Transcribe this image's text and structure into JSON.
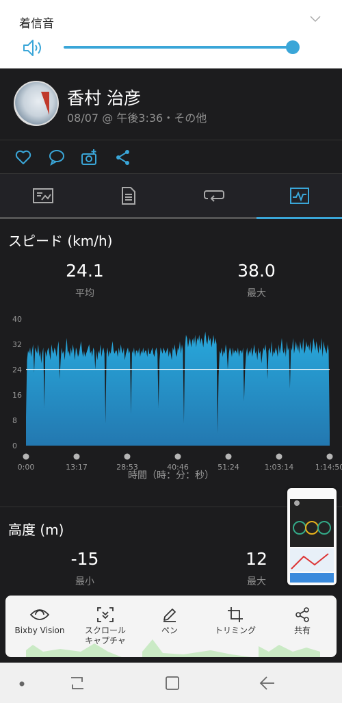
{
  "volume": {
    "title": "着信音",
    "level": 1.0
  },
  "activity": {
    "user_name": "香村 治彦",
    "meta": "08/07 @ 午後3:36・その他"
  },
  "actions": [
    "like-icon",
    "comment-icon",
    "add-photo-icon",
    "share-icon"
  ],
  "tabs": [
    {
      "name": "tab-overview",
      "icon": "map-stats-icon"
    },
    {
      "name": "tab-details",
      "icon": "document-icon"
    },
    {
      "name": "tab-laps",
      "icon": "laps-icon"
    },
    {
      "name": "tab-charts",
      "icon": "chart-icon",
      "selected": true
    }
  ],
  "speed": {
    "title": "スピード (km/h)",
    "avg_value": "24.1",
    "avg_label": "平均",
    "max_value": "38.0",
    "max_label": "最大"
  },
  "chart_data": {
    "type": "area",
    "title": "スピード (km/h)",
    "xlabel": "時間（時：分：秒）",
    "ylabel": "",
    "x_ticks": [
      "0:00",
      "13:17",
      "28:53",
      "40:46",
      "51:24",
      "1:03:14",
      "1:14:50"
    ],
    "y_ticks": [
      "0",
      "8",
      "16",
      "24",
      "32",
      "40"
    ],
    "ylim": [
      0,
      40
    ],
    "average_line": 24.1,
    "color": "#29a3d6",
    "values": [
      9,
      27,
      30,
      29,
      31,
      28,
      30,
      32,
      23,
      31,
      30,
      29,
      32,
      28,
      30,
      26,
      29,
      31,
      12,
      30,
      28,
      30,
      31,
      29,
      27,
      32,
      30,
      29,
      31,
      30,
      28,
      31,
      33,
      21,
      27,
      31,
      29,
      30,
      27,
      31,
      34,
      29,
      30,
      28,
      31,
      29,
      32,
      30,
      27,
      31,
      30,
      28,
      29,
      31,
      33,
      30,
      28,
      30,
      28,
      29,
      30,
      31,
      32,
      29,
      30,
      28,
      31,
      30,
      24,
      30,
      27,
      30,
      29,
      32,
      28,
      30,
      31,
      29,
      7,
      29,
      31,
      28,
      30,
      29,
      31,
      33,
      30,
      29,
      30,
      30,
      28,
      31,
      29,
      32,
      30,
      29,
      31,
      27,
      29,
      30,
      31,
      29,
      30,
      10,
      30,
      29,
      31,
      28,
      30,
      30,
      29,
      31,
      28,
      30,
      29,
      31,
      29,
      30,
      30,
      28,
      31,
      29,
      29,
      30,
      31,
      29,
      28,
      30,
      31,
      29,
      12,
      27,
      31,
      30,
      29,
      31,
      30,
      29,
      30,
      31,
      28,
      30,
      29,
      27,
      31,
      30,
      32,
      29,
      28,
      31,
      30,
      33,
      29,
      32,
      30,
      7,
      31,
      35,
      34,
      31,
      33,
      34,
      31,
      33,
      34,
      32,
      35,
      31,
      34,
      33,
      35,
      32,
      34,
      33,
      31,
      34,
      36,
      33,
      32,
      35,
      33,
      34,
      31,
      33,
      35,
      32,
      34,
      32,
      4,
      22,
      30,
      29,
      31,
      28,
      30,
      29,
      32,
      30,
      24,
      29,
      31,
      30,
      28,
      31,
      29,
      30,
      30,
      29,
      31,
      28,
      30,
      30,
      29,
      31,
      14,
      24,
      29,
      31,
      28,
      30,
      29,
      31,
      28,
      30,
      32,
      29,
      30,
      27,
      31,
      29,
      30,
      26,
      29,
      31,
      30,
      32,
      29,
      21,
      30,
      31,
      29,
      33,
      28,
      30,
      29,
      31,
      30,
      28,
      32,
      29,
      31,
      34,
      30,
      29,
      31,
      28,
      33,
      30,
      31,
      18,
      31,
      30,
      34,
      29,
      31,
      33,
      30,
      32,
      29,
      33,
      31,
      30,
      34,
      29,
      30,
      33,
      31,
      32,
      30,
      33,
      29,
      31,
      34,
      32,
      30,
      33,
      31,
      29,
      32,
      30,
      34,
      28,
      33,
      31,
      30,
      29,
      32,
      30,
      4
    ]
  },
  "altitude": {
    "title": "高度 (m)",
    "min_value": "-15",
    "min_label": "最小",
    "max_value": "12",
    "max_label": "最大"
  },
  "toolbar": [
    {
      "name": "bixby-vision-button",
      "icon": "eye-icon",
      "label": "Bixby Vision"
    },
    {
      "name": "scroll-capture-button",
      "icon": "scroll-capture-icon",
      "label": "スクロール\nキャプチャ"
    },
    {
      "name": "pen-button",
      "icon": "pen-icon",
      "label": "ペン"
    },
    {
      "name": "trim-button",
      "icon": "crop-icon",
      "label": "トリミング"
    },
    {
      "name": "share-button",
      "icon": "share-icon",
      "label": "共有"
    }
  ],
  "colors": {
    "accent": "#3aa6d8",
    "background": "#1c1c1e",
    "avg_line": "#ffffff"
  }
}
